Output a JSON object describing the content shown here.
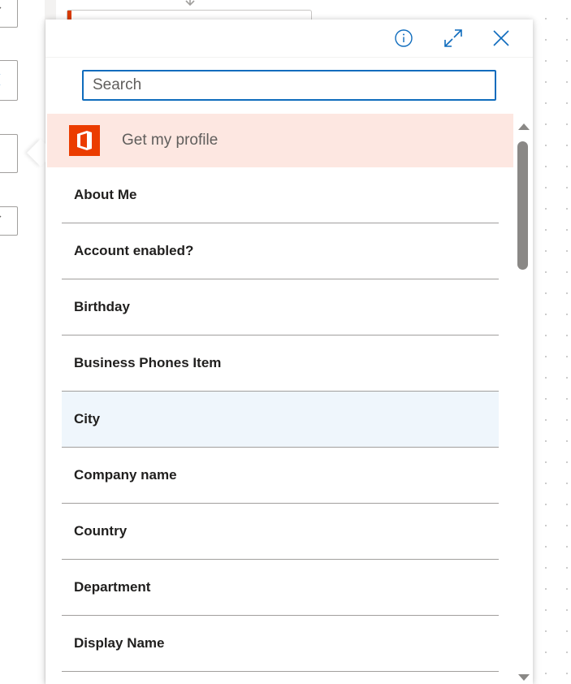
{
  "panel": {
    "info_icon": "info-icon",
    "expand_icon": "expand-icon",
    "close_icon": "close-icon"
  },
  "search": {
    "placeholder": "Search",
    "value": ""
  },
  "group": {
    "title": "Get my profile",
    "icon": "office-icon",
    "header_color": "#fde7e1",
    "icon_color": "#eb3c00"
  },
  "items": [
    {
      "label": "About Me"
    },
    {
      "label": "Account enabled?"
    },
    {
      "label": "Birthday"
    },
    {
      "label": "Business Phones Item"
    },
    {
      "label": "City"
    },
    {
      "label": "Company name"
    },
    {
      "label": "Country"
    },
    {
      "label": "Department"
    },
    {
      "label": "Display Name"
    }
  ],
  "colors": {
    "accent": "#0f6cbd",
    "hover_row": "#eff6fc"
  }
}
